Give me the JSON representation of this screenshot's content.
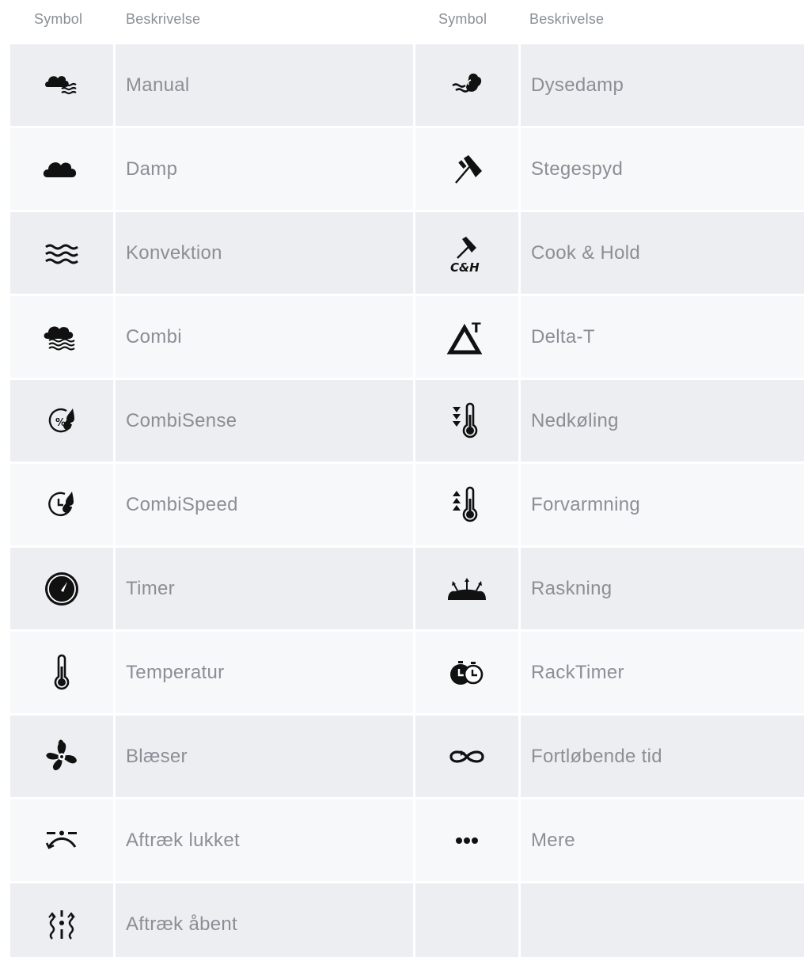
{
  "header": {
    "symbol_left": "Symbol",
    "description_left": "Beskrivelse",
    "symbol_right": "Symbol",
    "description_right": "Beskrivelse"
  },
  "rows": [
    {
      "left": {
        "icon": "manual-icon",
        "label": "Manual"
      },
      "right": {
        "icon": "nozzle-steam-icon",
        "label": "Dysedamp"
      }
    },
    {
      "left": {
        "icon": "steam-cloud-icon",
        "label": "Damp"
      },
      "right": {
        "icon": "spit-icon",
        "label": "Stegespyd"
      }
    },
    {
      "left": {
        "icon": "convection-icon",
        "label": "Konvektion"
      },
      "right": {
        "icon": "cook-hold-icon",
        "label": "Cook & Hold",
        "icon_text": "C&H"
      }
    },
    {
      "left": {
        "icon": "combi-icon",
        "label": "Combi"
      },
      "right": {
        "icon": "delta-t-icon",
        "label": "Delta-T",
        "icon_text": "T"
      }
    },
    {
      "left": {
        "icon": "combisense-icon",
        "label": "CombiSense",
        "icon_text": "%"
      },
      "right": {
        "icon": "cool-down-icon",
        "label": "Nedkøling"
      }
    },
    {
      "left": {
        "icon": "combispeed-icon",
        "label": "CombiSpeed"
      },
      "right": {
        "icon": "preheat-icon",
        "label": "Forvarmning"
      }
    },
    {
      "left": {
        "icon": "timer-icon",
        "label": "Timer"
      },
      "right": {
        "icon": "proofing-icon",
        "label": "Raskning"
      }
    },
    {
      "left": {
        "icon": "thermometer-icon",
        "label": "Temperatur"
      },
      "right": {
        "icon": "racktimer-icon",
        "label": "RackTimer"
      }
    },
    {
      "left": {
        "icon": "fan-icon",
        "label": "Blæser"
      },
      "right": {
        "icon": "continuous-time-icon",
        "label": "Fortløbende tid"
      }
    },
    {
      "left": {
        "icon": "vent-closed-icon",
        "label": "Aftræk lukket"
      },
      "right": {
        "icon": "more-icon",
        "label": "Mere"
      }
    },
    {
      "left": {
        "icon": "vent-open-icon",
        "label": "Aftræk åbent"
      },
      "right": {
        "icon": "",
        "label": ""
      }
    }
  ],
  "colors": {
    "row_dark": "#eceef1",
    "row_light": "#f7f8f9",
    "text": "#8a8f96",
    "icon": "#111111"
  }
}
